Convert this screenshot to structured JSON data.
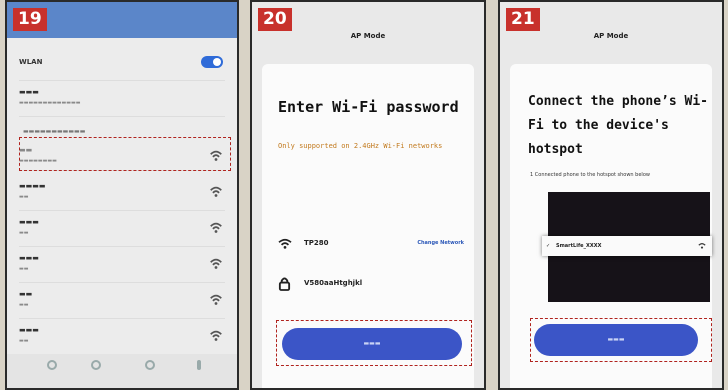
{
  "panels": {
    "p19": {
      "step_number": "19",
      "wifi_rows": [
        {
          "id": "selected"
        },
        {
          "id": "net2"
        },
        {
          "id": "net3"
        },
        {
          "id": "net4"
        },
        {
          "id": "net5"
        },
        {
          "id": "net6"
        }
      ]
    },
    "p20": {
      "step_number": "20",
      "header": "AP Mode",
      "title": "Enter Wi-Fi password",
      "note": "Only supported on 2.4GHz Wi-Fi networks",
      "ssid": "TP280",
      "change_network": "Change Network",
      "password": "V580aaHtghjkl"
    },
    "p21": {
      "step_number": "21",
      "header": "AP Mode",
      "title": "Connect the phone’s Wi-Fi to the device's hotspot",
      "step_text": "1 Connected phone to the hotspot shown below",
      "hotspot_check": "✓",
      "hotspot_ssid": "SmartLife_XXXX"
    }
  },
  "colors": {
    "badge": "#c8312c",
    "primary_button": "#3b55c7",
    "highlight_dash": "#b0231e",
    "toggle_on": "#2f6bd8",
    "note_orange": "#c27a1e"
  },
  "icons": [
    "wifi-signal-icon",
    "lock-icon",
    "toggle-switch",
    "check-icon"
  ]
}
